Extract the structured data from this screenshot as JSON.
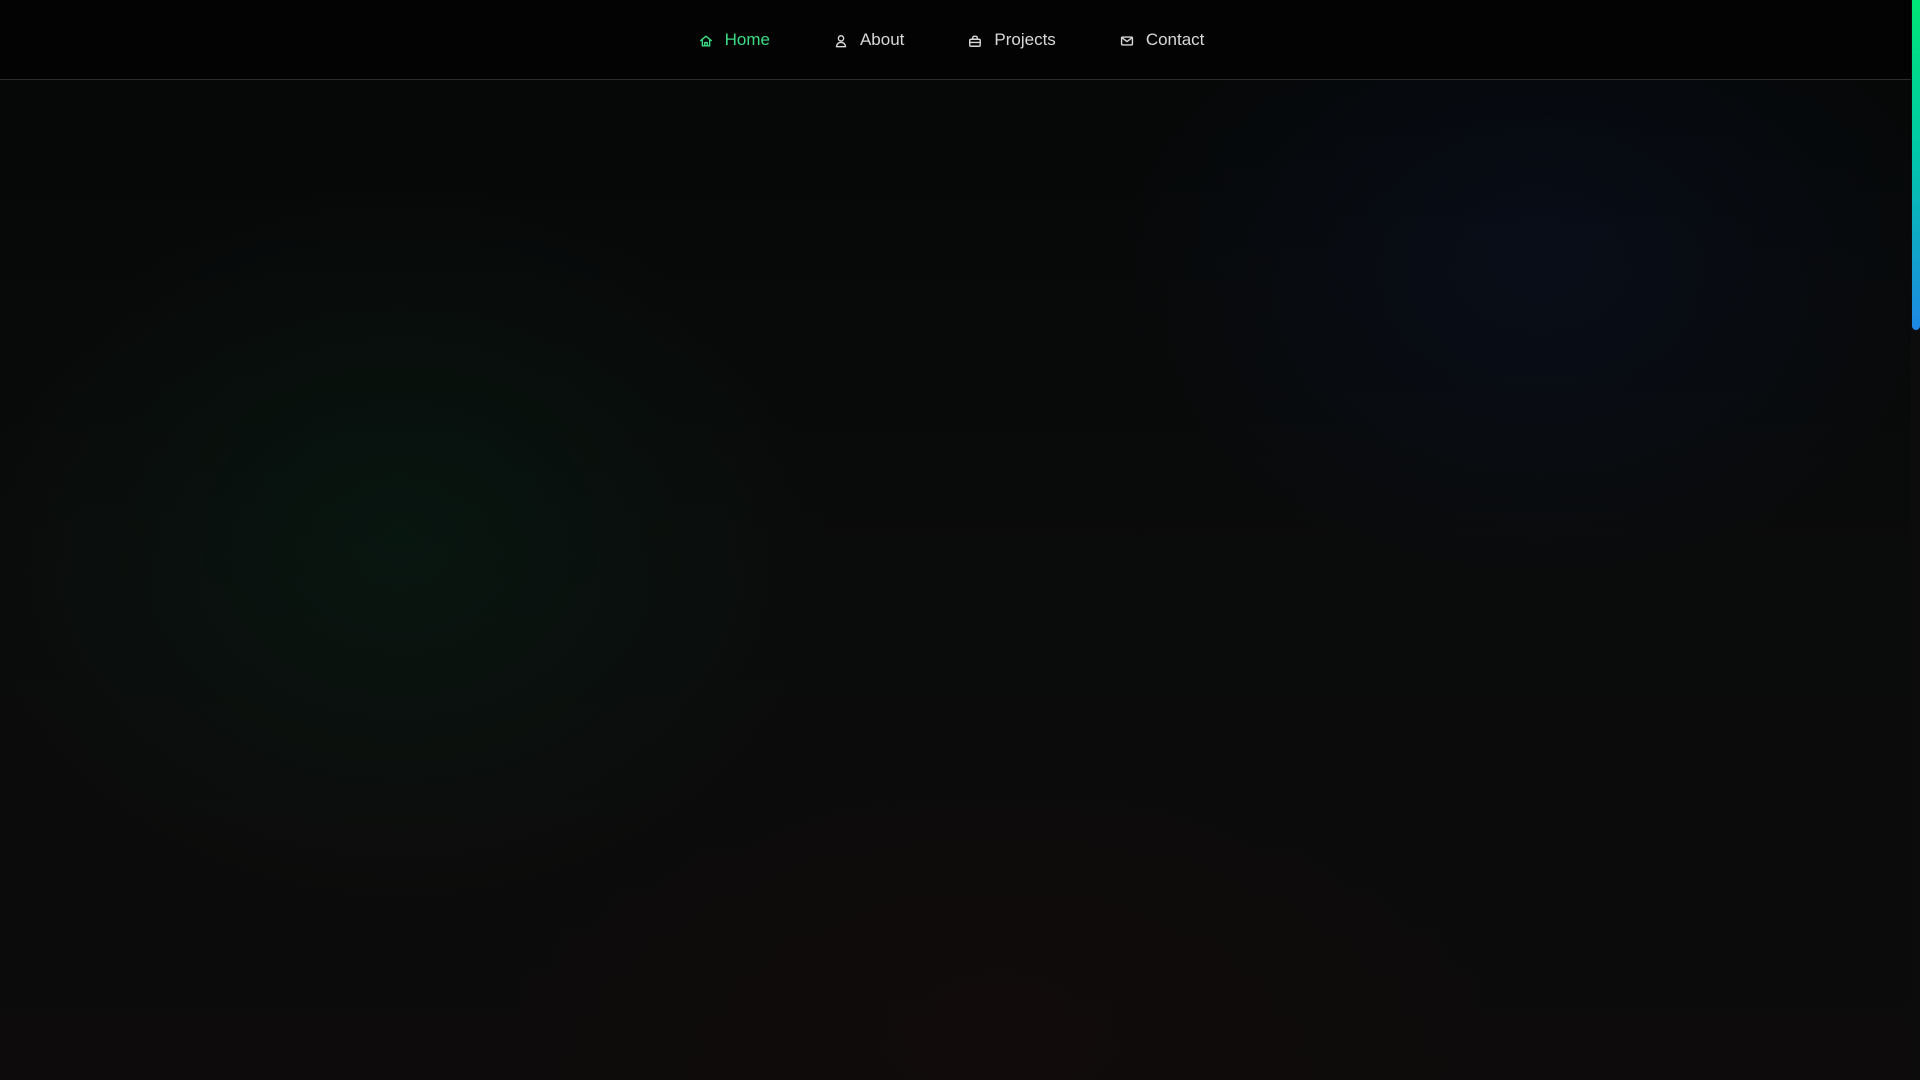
{
  "nav": {
    "items": [
      {
        "label": "Home",
        "icon": "home-icon",
        "active": true
      },
      {
        "label": "About",
        "icon": "user-icon",
        "active": false
      },
      {
        "label": "Projects",
        "icon": "briefcase-icon",
        "active": false
      },
      {
        "label": "Contact",
        "icon": "mail-icon",
        "active": false
      }
    ]
  },
  "scrollbar": {
    "position_fraction": 0.0,
    "thumb_colors": [
      "#00e676",
      "#00c9a7",
      "#1e88e5"
    ]
  },
  "theme": {
    "accent": "#3ddc84",
    "nav_text": "#d8d8d8",
    "background": "#0b0b0c"
  }
}
